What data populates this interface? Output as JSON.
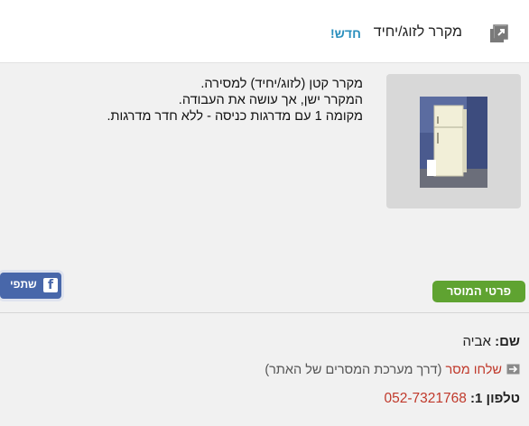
{
  "header": {
    "title": "מקרר לזוג/יחיד",
    "new_label": "חדש!",
    "expand_icon": "external-link-icon"
  },
  "listing": {
    "photo_icon": "fridge-photo",
    "description_lines": [
      "מקרר קטן (לזוג/יחיד) למסירה.",
      "המקרר ישן, אך עושה את העבודה.",
      "מקומה 1 עם מדרגות כניסה - ללא חדר מדרגות."
    ]
  },
  "actions": {
    "share_label": "שתפי",
    "share_icon": "facebook-icon",
    "seller_details_label": "פרטי המוסר"
  },
  "seller": {
    "name_label": "שם:",
    "name_value": "אביה",
    "send_link": "שלחו מסר",
    "send_note": "(דרך מערכת המסרים של האתר)",
    "send_icon": "envelope-arrow-icon",
    "phone_label": "טלפון 1:",
    "phone_value": "052-7321768"
  },
  "colors": {
    "new_badge": "#2a8fbd",
    "seller_button": "#5fa331",
    "facebook": "#4867aa",
    "link_red": "#c0392b"
  }
}
